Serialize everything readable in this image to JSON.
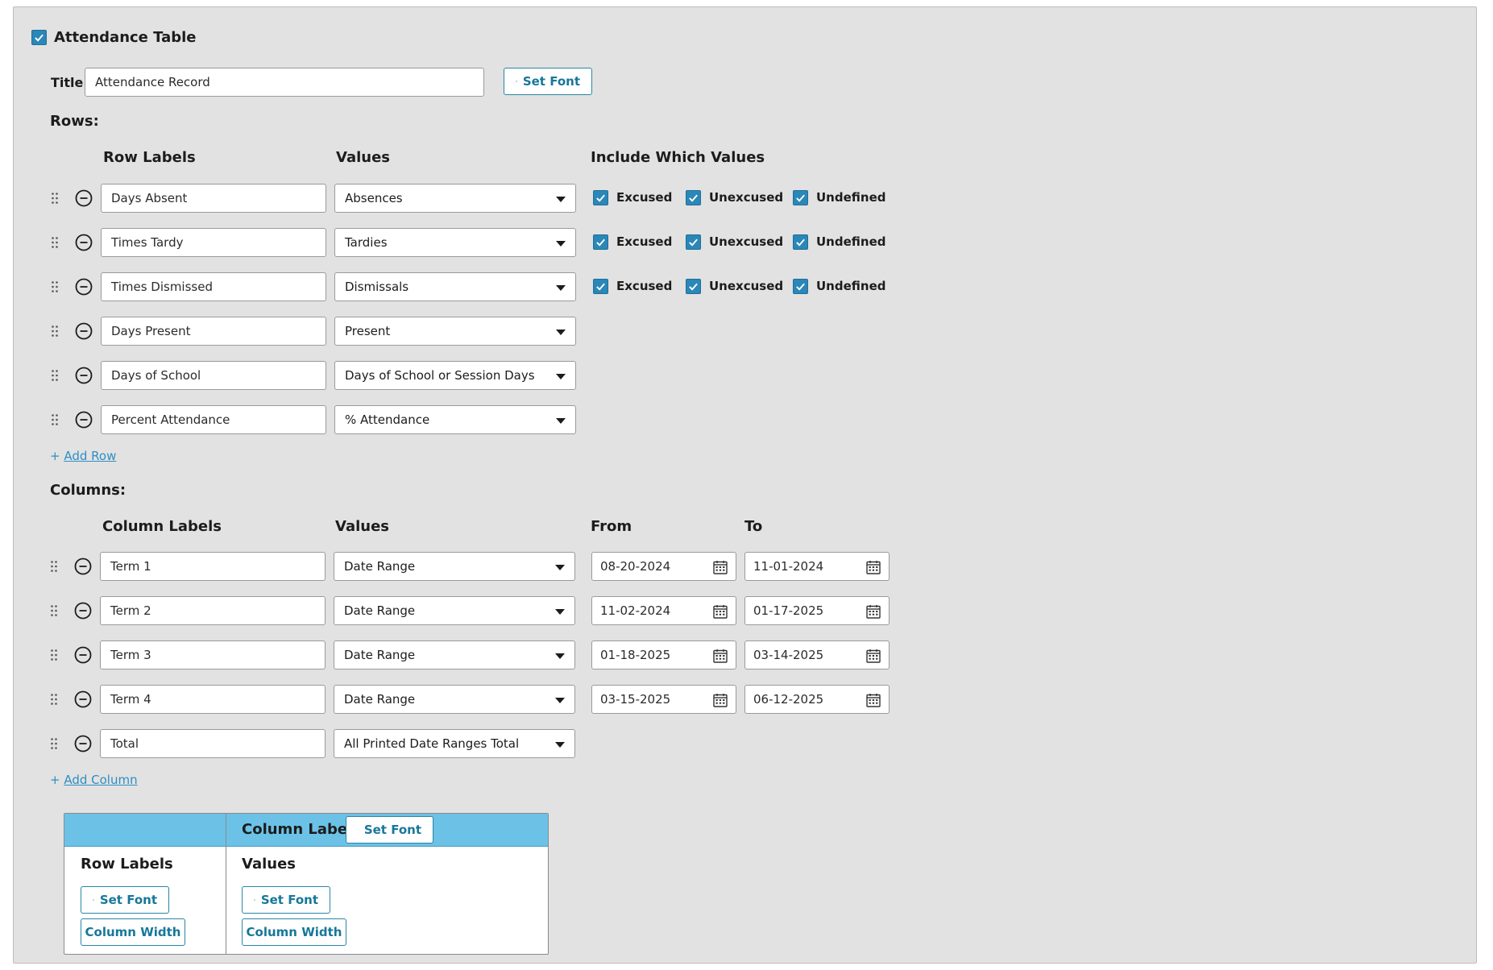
{
  "header": {
    "enabled": true,
    "title": "Attendance Table"
  },
  "title_field": {
    "label": "Title",
    "value": "Attendance Record",
    "set_font_label": "Set Font"
  },
  "rows_section": {
    "label": "Rows:",
    "headers": {
      "row_labels": "Row Labels",
      "values": "Values",
      "include": "Include Which Values"
    },
    "rows": [
      {
        "label": "Days Absent",
        "value": "Absences",
        "include": [
          {
            "name": "Excused",
            "checked": true
          },
          {
            "name": "Unexcused",
            "checked": true
          },
          {
            "name": "Undefined",
            "checked": true
          }
        ]
      },
      {
        "label": "Times Tardy",
        "value": "Tardies",
        "include": [
          {
            "name": "Excused",
            "checked": true
          },
          {
            "name": "Unexcused",
            "checked": true
          },
          {
            "name": "Undefined",
            "checked": true
          }
        ]
      },
      {
        "label": "Times Dismissed",
        "value": "Dismissals",
        "include": [
          {
            "name": "Excused",
            "checked": true
          },
          {
            "name": "Unexcused",
            "checked": true
          },
          {
            "name": "Undefined",
            "checked": true
          }
        ]
      },
      {
        "label": "Days Present",
        "value": "Present"
      },
      {
        "label": "Days of School",
        "value": "Days of School or Session Days"
      },
      {
        "label": "Percent Attendance",
        "value": "% Attendance"
      }
    ],
    "add_label": "+ ",
    "add_link": "Add Row"
  },
  "columns_section": {
    "label": "Columns:",
    "headers": {
      "column_labels": "Column Labels",
      "values": "Values",
      "from": "From",
      "to": "To"
    },
    "columns": [
      {
        "label": "Term 1",
        "value": "Date Range",
        "from": "08-20-2024",
        "to": "11-01-2024"
      },
      {
        "label": "Term 2",
        "value": "Date Range",
        "from": "11-02-2024",
        "to": "01-17-2025"
      },
      {
        "label": "Term 3",
        "value": "Date Range",
        "from": "01-18-2025",
        "to": "03-14-2025"
      },
      {
        "label": "Term 4",
        "value": "Date Range",
        "from": "03-15-2025",
        "to": "06-12-2025"
      },
      {
        "label": "Total",
        "value": "All Printed Date Ranges Total"
      }
    ],
    "add_label": "+ ",
    "add_link": "Add Column"
  },
  "layout_box": {
    "column_labels": "Column Labels",
    "row_labels": "Row Labels",
    "values": "Values",
    "set_font": "Set Font",
    "column_width": "Column Width"
  },
  "colors": {
    "panel": "#e2e2e2",
    "accent": "#2a87b8",
    "header_band": "#6bc2e6",
    "link": "#2d8fc4"
  }
}
